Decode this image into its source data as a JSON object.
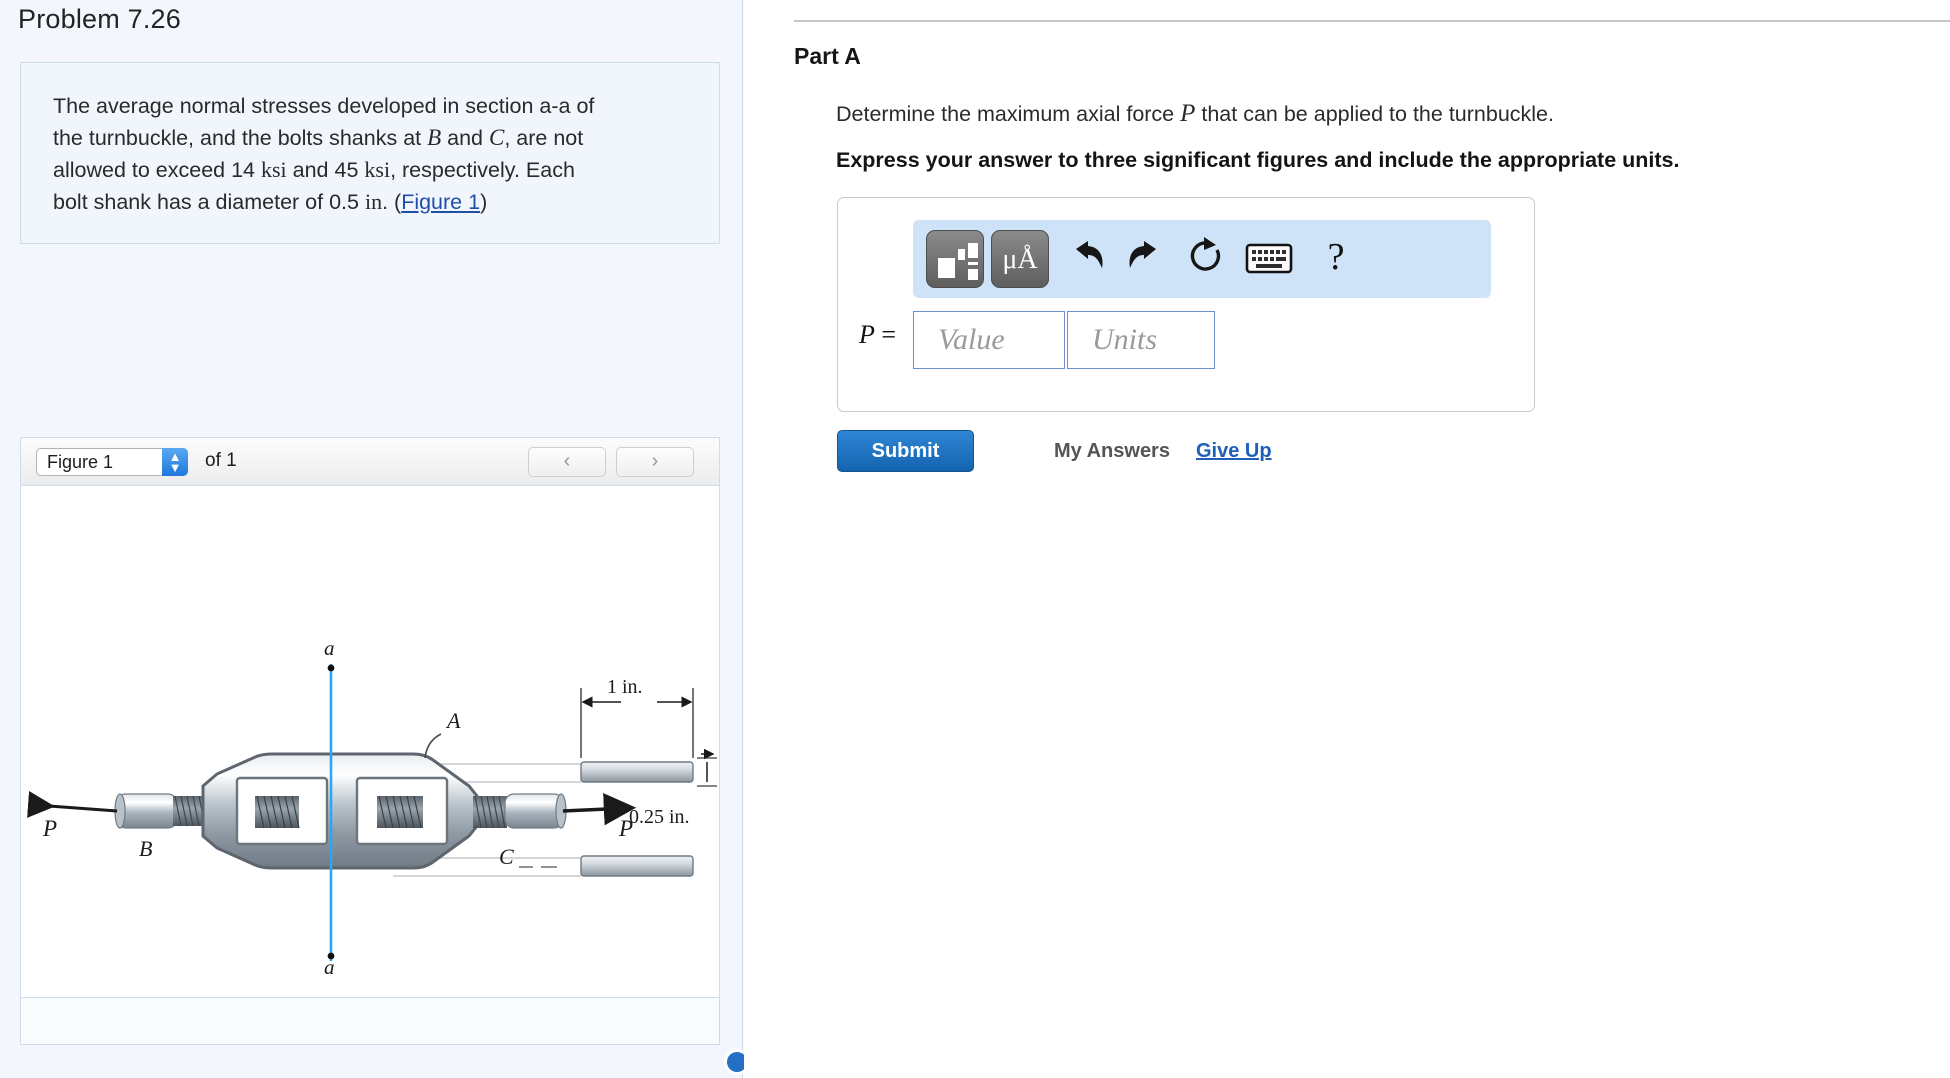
{
  "left": {
    "problem_title": "Problem 7.26",
    "statement": {
      "line1": "The average normal stresses developed in section a-a of",
      "line2_a": "the turnbuckle, and the bolts shanks at ",
      "line2_B": "B",
      "line2_and": " and ",
      "line2_C": "C",
      "line2_b": ", are not",
      "line3_a": "allowed to exceed 14  ",
      "line3_ksi1": "ksi",
      "line3_b": " and 45 ",
      "line3_ksi2": "ksi",
      "line3_c": ", respectively. Each",
      "line4_a": "bolt shank has a diameter of 0.5 ",
      "line4_in": "in",
      "line4_b": ". (",
      "link": "Figure 1",
      "line4_c": ")"
    },
    "figure_toolbar": {
      "selected_figure": "Figure 1",
      "of_label": "of 1",
      "prev_icon": "chevron-left-icon",
      "next_icon": "chevron-right-icon",
      "stepper_icon": "stepper-up-down-icon"
    },
    "figure": {
      "caption_a_top": "a",
      "caption_a_bottom": "a",
      "label_A": "A",
      "label_B": "B",
      "label_C": "C",
      "label_P_left": "P",
      "label_P_right": "P",
      "dim_width": "1 in.",
      "dim_thickness": "0.25 in.",
      "section_line_color": "#2aa8ef",
      "body_color": "#9aa5ad"
    },
    "pane_handle_color": "#2470c4"
  },
  "right": {
    "part_title": "Part A",
    "question": {
      "pre": "Determine the maximum axial force ",
      "symbol": "P",
      "post": " that can be applied to the turnbuckle."
    },
    "instruction": "Express your answer to three significant figures and include the appropriate units.",
    "answer": {
      "variable": "P",
      "equals": "=",
      "value_placeholder": "Value",
      "units_placeholder": "Units",
      "toolbar": {
        "template_icon": "math-template-icon",
        "units_icon": "micro-angstrom-units-icon",
        "units_label_mu": "μ",
        "units_label_angstrom": "Å",
        "undo_icon": "undo-arrow-icon",
        "redo_icon": "redo-arrow-icon",
        "reset_icon": "reset-circular-arrow-icon",
        "keyboard_icon": "keyboard-icon",
        "help_icon": "question-mark-icon",
        "help_label": "?",
        "background_color": "#cee2f8"
      }
    },
    "actions": {
      "submit_label": "Submit",
      "my_answers_label": "My Answers",
      "give_up_label": "Give Up",
      "submit_color": "#1d6ebb",
      "link_color": "#1f5fb8"
    }
  }
}
